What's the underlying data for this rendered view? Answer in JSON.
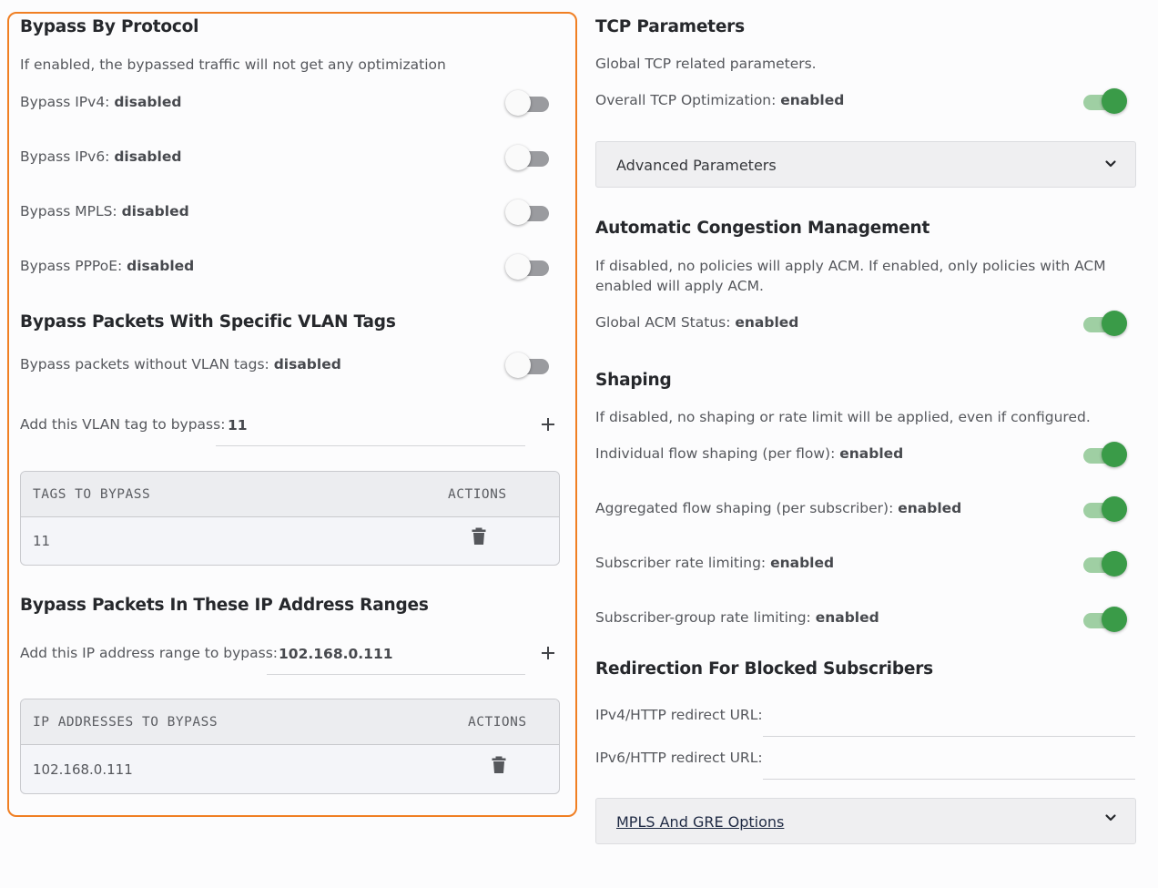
{
  "bypass_protocol": {
    "title": "Bypass By Protocol",
    "description": "If enabled, the bypassed traffic will not get any optimization",
    "items": [
      {
        "label": "Bypass IPv4: ",
        "status": "disabled"
      },
      {
        "label": "Bypass IPv6: ",
        "status": "disabled"
      },
      {
        "label": "Bypass MPLS: ",
        "status": "disabled"
      },
      {
        "label": "Bypass PPPoE: ",
        "status": "disabled"
      }
    ]
  },
  "vlan": {
    "title": "Bypass Packets With Specific VLAN Tags",
    "no_tag_label": "Bypass packets without VLAN tags: ",
    "no_tag_status": "disabled",
    "add_label": "Add this VLAN tag to bypass:",
    "add_value": "11",
    "table": {
      "header_tags": "TAGS TO BYPASS",
      "header_actions": "ACTIONS",
      "rows": [
        "11"
      ]
    }
  },
  "ip_ranges": {
    "title": "Bypass Packets In These IP Address Ranges",
    "add_label": "Add this IP address range to bypass:",
    "add_value": "102.168.0.111",
    "table": {
      "header_ips": "IP ADDRESSES TO BYPASS",
      "header_actions": "ACTIONS",
      "rows": [
        "102.168.0.111"
      ]
    }
  },
  "tcp": {
    "title": "TCP Parameters",
    "description": "Global TCP related parameters.",
    "optimization_label": "Overall TCP Optimization: ",
    "optimization_status": "enabled",
    "advanced_label": "Advanced Parameters"
  },
  "acm": {
    "title": "Automatic Congestion Management",
    "description": "If disabled, no policies will apply ACM. If enabled, only policies with ACM enabled will apply ACM.",
    "status_label": "Global ACM Status: ",
    "status": "enabled"
  },
  "shaping": {
    "title": "Shaping",
    "description": "If disabled, no shaping or rate limit will be applied, even if configured.",
    "items": [
      {
        "label": "Individual flow shaping (per flow): ",
        "status": "enabled"
      },
      {
        "label": "Aggregated flow shaping (per subscriber): ",
        "status": "enabled"
      },
      {
        "label": "Subscriber rate limiting: ",
        "status": "enabled"
      },
      {
        "label": "Subscriber-group rate limiting: ",
        "status": "enabled"
      }
    ]
  },
  "redirection": {
    "title": "Redirection For Blocked Subscribers",
    "ipv4_label": "IPv4/HTTP redirect URL:",
    "ipv4_value": "",
    "ipv6_label": "IPv6/HTTP redirect URL:",
    "ipv6_value": ""
  },
  "mpls_gre": {
    "label": "MPLS And GRE Options"
  },
  "colors": {
    "accent_border": "#f07f23",
    "toggle_on": "#3a9b48",
    "toggle_on_track": "#9fcfa3",
    "toggle_off_track": "#9a9b9f"
  },
  "icons": [
    "plus-icon",
    "trash-icon",
    "chevron-down-icon"
  ]
}
